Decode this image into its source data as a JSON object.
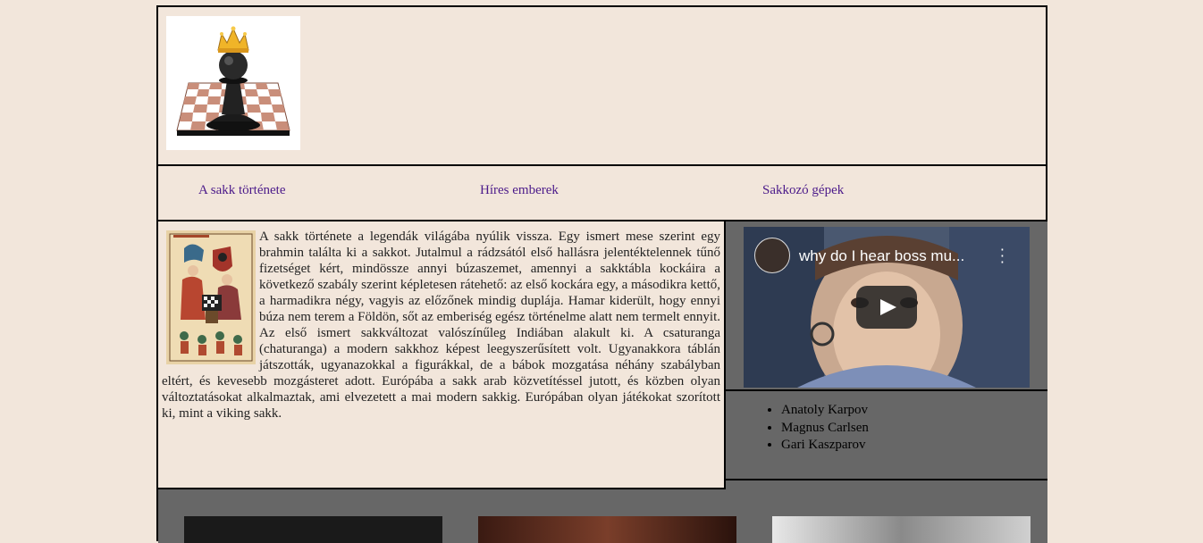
{
  "nav": {
    "items": [
      {
        "label": "A sakk története"
      },
      {
        "label": "Híres emberek"
      },
      {
        "label": "Sakkozó gépek"
      }
    ]
  },
  "article": {
    "text": "A sakk története a legendák világába nyúlik vissza. Egy ismert mese szerint egy brahmin találta ki a sakkot. Jutalmul a rádzsától első hallásra jelentéktelennek tűnő fizetséget kért, mindössze annyi búzaszemet, amennyi a sakktábla kockáira a következő szabály szerint képletesen rátehető: az első kockára egy, a másodikra kettő, a harmadikra négy, vagyis az előzőnek mindig duplája. Hamar kiderült, hogy ennyi búza nem terem a Földön, sőt az emberiség egész történelme alatt nem termelt ennyit. Az első ismert sakkváltozat valószínűleg Indiában alakult ki. A csaturanga (chaturanga) a modern sakkhoz képest leegyszerűsített volt. Ugyanakkora táblán játszották, ugyanazokkal a figurákkal, de a bábok mozgatása néhány szabályban eltért, és kevesebb mozgásteret adott. Európába a sakk arab közvetítéssel jutott, és közben olyan változtatásokat alkalmaztak, ami elvezetett a mai modern sakkig. Európában olyan játékokat szorított ki, mint a viking sakk."
  },
  "video": {
    "title": "why do I hear boss mu..."
  },
  "people": [
    {
      "name": "Anatoly Karpov"
    },
    {
      "name": "Magnus Carlsen"
    },
    {
      "name": "Gari Kaszparov"
    }
  ]
}
